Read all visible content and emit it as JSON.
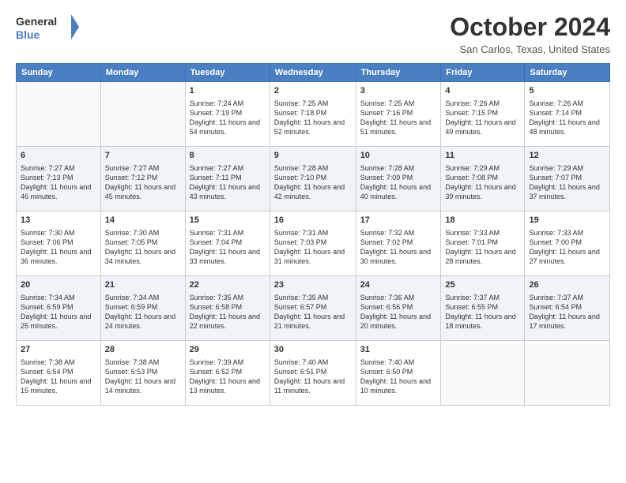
{
  "header": {
    "logo_line1": "General",
    "logo_line2": "Blue",
    "month": "October 2024",
    "location": "San Carlos, Texas, United States"
  },
  "days_of_week": [
    "Sunday",
    "Monday",
    "Tuesday",
    "Wednesday",
    "Thursday",
    "Friday",
    "Saturday"
  ],
  "weeks": [
    [
      {
        "day": "",
        "sunrise": "",
        "sunset": "",
        "daylight": ""
      },
      {
        "day": "",
        "sunrise": "",
        "sunset": "",
        "daylight": ""
      },
      {
        "day": "1",
        "sunrise": "Sunrise: 7:24 AM",
        "sunset": "Sunset: 7:19 PM",
        "daylight": "Daylight: 11 hours and 54 minutes."
      },
      {
        "day": "2",
        "sunrise": "Sunrise: 7:25 AM",
        "sunset": "Sunset: 7:18 PM",
        "daylight": "Daylight: 11 hours and 52 minutes."
      },
      {
        "day": "3",
        "sunrise": "Sunrise: 7:25 AM",
        "sunset": "Sunset: 7:16 PM",
        "daylight": "Daylight: 11 hours and 51 minutes."
      },
      {
        "day": "4",
        "sunrise": "Sunrise: 7:26 AM",
        "sunset": "Sunset: 7:15 PM",
        "daylight": "Daylight: 11 hours and 49 minutes."
      },
      {
        "day": "5",
        "sunrise": "Sunrise: 7:26 AM",
        "sunset": "Sunset: 7:14 PM",
        "daylight": "Daylight: 11 hours and 48 minutes."
      }
    ],
    [
      {
        "day": "6",
        "sunrise": "Sunrise: 7:27 AM",
        "sunset": "Sunset: 7:13 PM",
        "daylight": "Daylight: 11 hours and 46 minutes."
      },
      {
        "day": "7",
        "sunrise": "Sunrise: 7:27 AM",
        "sunset": "Sunset: 7:12 PM",
        "daylight": "Daylight: 11 hours and 45 minutes."
      },
      {
        "day": "8",
        "sunrise": "Sunrise: 7:27 AM",
        "sunset": "Sunset: 7:11 PM",
        "daylight": "Daylight: 11 hours and 43 minutes."
      },
      {
        "day": "9",
        "sunrise": "Sunrise: 7:28 AM",
        "sunset": "Sunset: 7:10 PM",
        "daylight": "Daylight: 11 hours and 42 minutes."
      },
      {
        "day": "10",
        "sunrise": "Sunrise: 7:28 AM",
        "sunset": "Sunset: 7:09 PM",
        "daylight": "Daylight: 11 hours and 40 minutes."
      },
      {
        "day": "11",
        "sunrise": "Sunrise: 7:29 AM",
        "sunset": "Sunset: 7:08 PM",
        "daylight": "Daylight: 11 hours and 39 minutes."
      },
      {
        "day": "12",
        "sunrise": "Sunrise: 7:29 AM",
        "sunset": "Sunset: 7:07 PM",
        "daylight": "Daylight: 11 hours and 37 minutes."
      }
    ],
    [
      {
        "day": "13",
        "sunrise": "Sunrise: 7:30 AM",
        "sunset": "Sunset: 7:06 PM",
        "daylight": "Daylight: 11 hours and 36 minutes."
      },
      {
        "day": "14",
        "sunrise": "Sunrise: 7:30 AM",
        "sunset": "Sunset: 7:05 PM",
        "daylight": "Daylight: 11 hours and 34 minutes."
      },
      {
        "day": "15",
        "sunrise": "Sunrise: 7:31 AM",
        "sunset": "Sunset: 7:04 PM",
        "daylight": "Daylight: 11 hours and 33 minutes."
      },
      {
        "day": "16",
        "sunrise": "Sunrise: 7:31 AM",
        "sunset": "Sunset: 7:03 PM",
        "daylight": "Daylight: 11 hours and 31 minutes."
      },
      {
        "day": "17",
        "sunrise": "Sunrise: 7:32 AM",
        "sunset": "Sunset: 7:02 PM",
        "daylight": "Daylight: 11 hours and 30 minutes."
      },
      {
        "day": "18",
        "sunrise": "Sunrise: 7:33 AM",
        "sunset": "Sunset: 7:01 PM",
        "daylight": "Daylight: 11 hours and 28 minutes."
      },
      {
        "day": "19",
        "sunrise": "Sunrise: 7:33 AM",
        "sunset": "Sunset: 7:00 PM",
        "daylight": "Daylight: 11 hours and 27 minutes."
      }
    ],
    [
      {
        "day": "20",
        "sunrise": "Sunrise: 7:34 AM",
        "sunset": "Sunset: 6:59 PM",
        "daylight": "Daylight: 11 hours and 25 minutes."
      },
      {
        "day": "21",
        "sunrise": "Sunrise: 7:34 AM",
        "sunset": "Sunset: 6:59 PM",
        "daylight": "Daylight: 11 hours and 24 minutes."
      },
      {
        "day": "22",
        "sunrise": "Sunrise: 7:35 AM",
        "sunset": "Sunset: 6:58 PM",
        "daylight": "Daylight: 11 hours and 22 minutes."
      },
      {
        "day": "23",
        "sunrise": "Sunrise: 7:35 AM",
        "sunset": "Sunset: 6:57 PM",
        "daylight": "Daylight: 11 hours and 21 minutes."
      },
      {
        "day": "24",
        "sunrise": "Sunrise: 7:36 AM",
        "sunset": "Sunset: 6:56 PM",
        "daylight": "Daylight: 11 hours and 20 minutes."
      },
      {
        "day": "25",
        "sunrise": "Sunrise: 7:37 AM",
        "sunset": "Sunset: 6:55 PM",
        "daylight": "Daylight: 11 hours and 18 minutes."
      },
      {
        "day": "26",
        "sunrise": "Sunrise: 7:37 AM",
        "sunset": "Sunset: 6:54 PM",
        "daylight": "Daylight: 11 hours and 17 minutes."
      }
    ],
    [
      {
        "day": "27",
        "sunrise": "Sunrise: 7:38 AM",
        "sunset": "Sunset: 6:54 PM",
        "daylight": "Daylight: 11 hours and 15 minutes."
      },
      {
        "day": "28",
        "sunrise": "Sunrise: 7:38 AM",
        "sunset": "Sunset: 6:53 PM",
        "daylight": "Daylight: 11 hours and 14 minutes."
      },
      {
        "day": "29",
        "sunrise": "Sunrise: 7:39 AM",
        "sunset": "Sunset: 6:52 PM",
        "daylight": "Daylight: 11 hours and 13 minutes."
      },
      {
        "day": "30",
        "sunrise": "Sunrise: 7:40 AM",
        "sunset": "Sunset: 6:51 PM",
        "daylight": "Daylight: 11 hours and 11 minutes."
      },
      {
        "day": "31",
        "sunrise": "Sunrise: 7:40 AM",
        "sunset": "Sunset: 6:50 PM",
        "daylight": "Daylight: 11 hours and 10 minutes."
      },
      {
        "day": "",
        "sunrise": "",
        "sunset": "",
        "daylight": ""
      },
      {
        "day": "",
        "sunrise": "",
        "sunset": "",
        "daylight": ""
      }
    ]
  ]
}
